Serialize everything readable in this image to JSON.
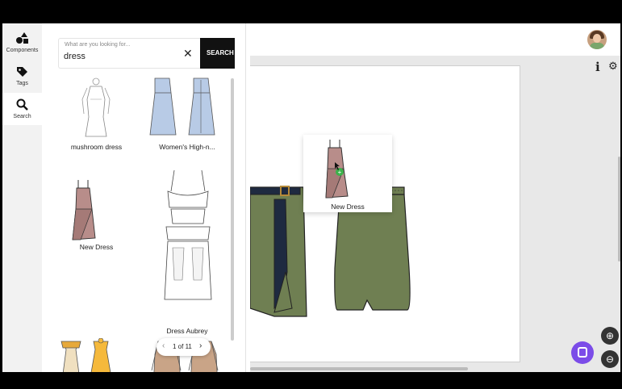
{
  "nav": {
    "items": [
      {
        "label": "Components",
        "icon": "shapes-icon"
      },
      {
        "label": "Tags",
        "icon": "tag-icon"
      },
      {
        "label": "Search",
        "icon": "search-icon"
      }
    ]
  },
  "search": {
    "hint": "What are you looking for...",
    "value": "dress",
    "button_label": "SEARCH"
  },
  "results": [
    {
      "label": "mushroom dress",
      "icon": "sketch-dress-icon"
    },
    {
      "label": "Women's High-n...",
      "icon": "blue-dress-icon"
    },
    {
      "label": "New Dress",
      "icon": "pink-dress-icon"
    },
    {
      "label": "",
      "icon": "ruffle-dress-icon"
    },
    {
      "label": "",
      "icon": "yellow-dress-icon"
    },
    {
      "label": "Dress Aubrey",
      "icon": "tan-dress-icon"
    }
  ],
  "pager": {
    "text": "1 of 11"
  },
  "drag_card": {
    "label": "New Dress"
  },
  "canvas": {
    "skirt_color": "#6f7f52"
  },
  "accent": {
    "chat": "#7b4ce8",
    "add": "#3bb24a"
  }
}
